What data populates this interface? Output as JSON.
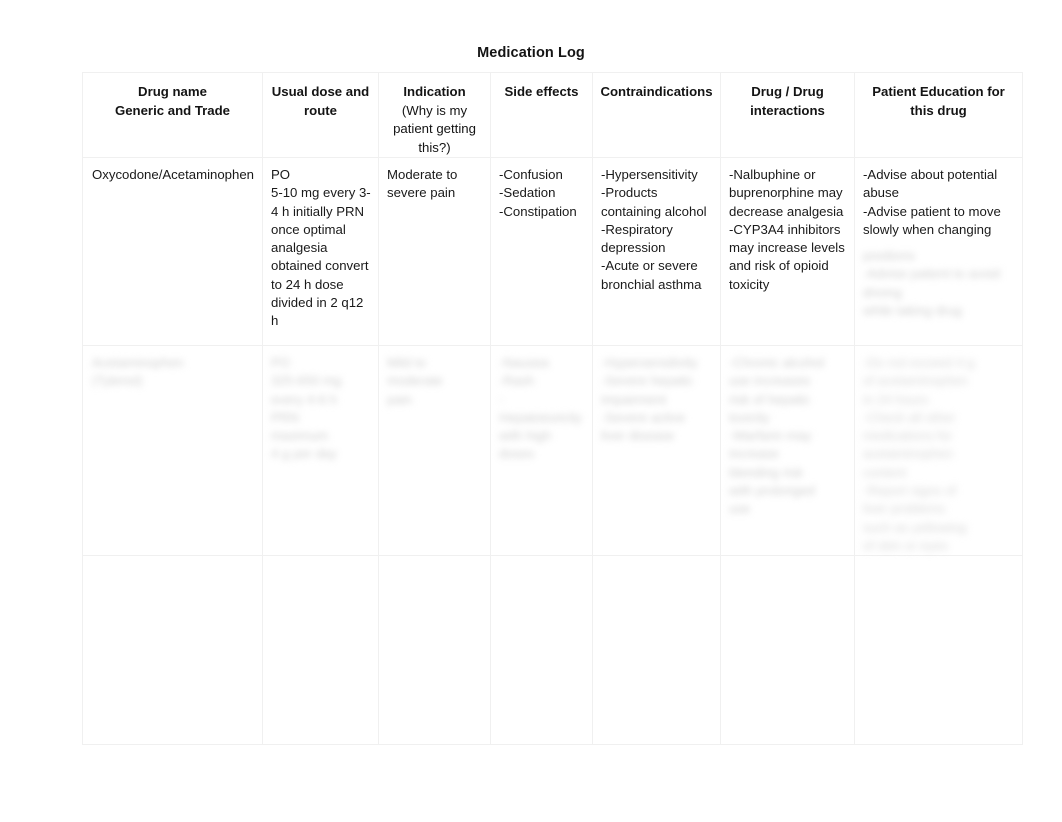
{
  "document": {
    "title": "Medication Log"
  },
  "table": {
    "columns": [
      {
        "title": "Drug name",
        "subtitle": "Generic and Trade",
        "subtitle_bold": true
      },
      {
        "title": "Usual dose and route",
        "subtitle": "",
        "subtitle_bold": true
      },
      {
        "title": "Indication",
        "subtitle": "(Why is my patient getting this?)",
        "subtitle_bold": false
      },
      {
        "title": "Side effects",
        "subtitle": "",
        "subtitle_bold": true
      },
      {
        "title": "Contraindications",
        "subtitle": "",
        "subtitle_bold": true
      },
      {
        "title": "Drug / Drug interactions",
        "subtitle": "",
        "subtitle_bold": true
      },
      {
        "title": "Patient Education for this drug",
        "subtitle": "",
        "subtitle_bold": true
      }
    ],
    "rows": [
      {
        "drug_name": "Oxycodone/Acetaminophen",
        "dose_route": "PO\n5-10 mg every 3-4 h initially PRN once optimal analgesia obtained convert to 24 h dose divided in 2 q12 h",
        "indication": "Moderate to severe pain",
        "side_effects": "-Confusion\n-Sedation\n-Constipation",
        "contraindications": "-Hypersensitivity\n-Products containing alcohol\n-Respiratory depression\n-Acute or severe bronchial asthma",
        "interactions": "-Nalbuphine or buprenorphine may decrease analgesia\n-CYP3A4 inhibitors may increase levels and risk of opioid toxicity",
        "patient_education": "-Advise about potential abuse\n-Advise patient to move slowly when changing",
        "patient_education_redacted": "positions\n-Advise patient to avoid driving\nwhile taking drug"
      },
      {
        "drug_name_redacted": "Acetaminophen\n(Tylenol)",
        "dose_route_redacted": "PO\n325-650 mg\nevery 4-6 h\nPRN\nmaximum\n4 g per day",
        "indication_redacted": "Mild to\nmoderate\npain",
        "side_effects_redacted": "-Nausea\n-Rash\n-Hepatotoxicity\nwith high\ndoses",
        "contraindications_redacted": "-Hypersensitivity\n-Severe hepatic\nimpairment\n-Severe active\nliver disease",
        "interactions_redacted": "-Chronic alcohol\nuse increases\nrisk of hepatic\ntoxicity\n-Warfarin may\nincrease\nbleeding risk\nwith prolonged\nuse",
        "patient_education_redacted": "-Do not exceed 4 g\nof acetaminophen\nin 24 hours\n-Check all other\nmedications for\nacetaminophen\ncontent\n-Report signs of\nliver problems\nsuch as yellowing\nof skin or eyes"
      },
      {
        "drug_name": "",
        "dose_route": "",
        "indication": "",
        "side_effects": "",
        "contraindications": "",
        "interactions": "",
        "patient_education": ""
      }
    ]
  }
}
